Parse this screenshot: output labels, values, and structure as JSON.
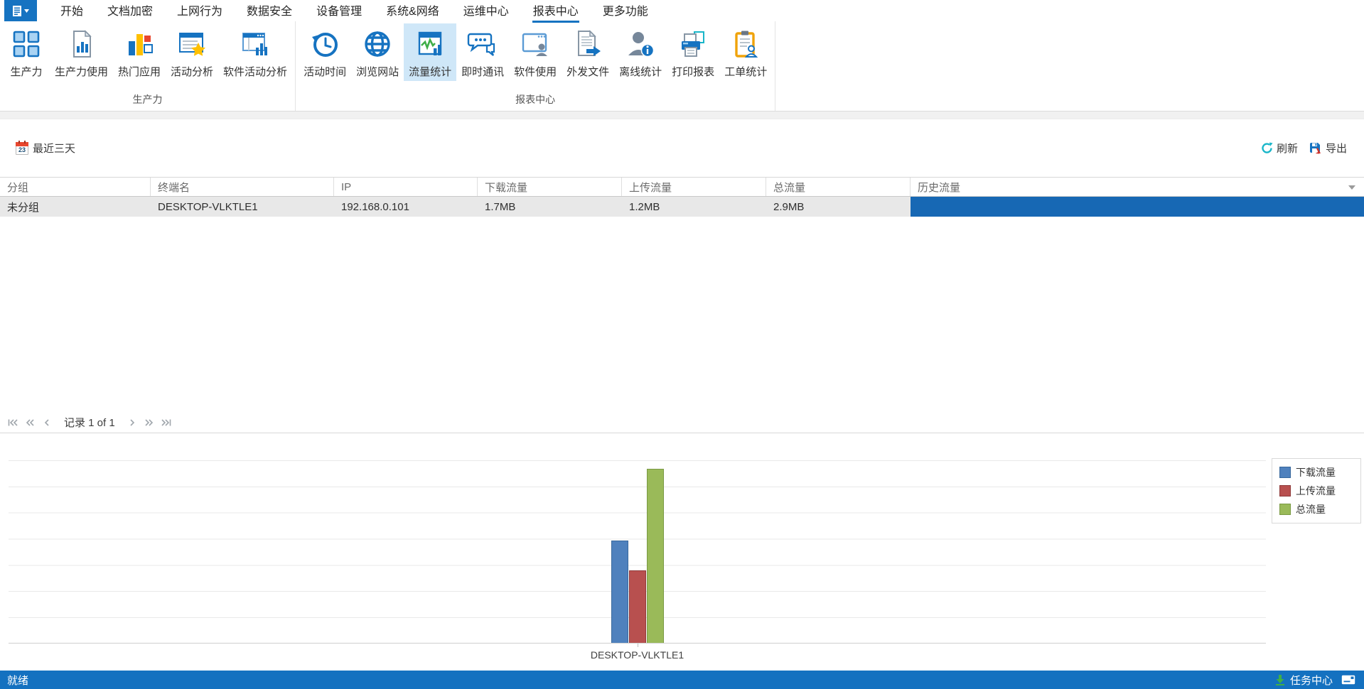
{
  "colors": {
    "accent": "#1673c1",
    "statusbar_bg": "#1471c0",
    "history_bar": "#1768b4",
    "selected_button_bg": "#cfe7f8",
    "row_bg": "#e8e8e8"
  },
  "app": {
    "menu_icon": "document-menu-icon",
    "tabs": [
      {
        "label": "开始",
        "selected": false
      },
      {
        "label": "文档加密",
        "selected": false
      },
      {
        "label": "上网行为",
        "selected": false
      },
      {
        "label": "数据安全",
        "selected": false
      },
      {
        "label": "设备管理",
        "selected": false
      },
      {
        "label": "系统&网络",
        "selected": false
      },
      {
        "label": "运维中心",
        "selected": false
      },
      {
        "label": "报表中心",
        "selected": true
      },
      {
        "label": "更多功能",
        "selected": false
      }
    ]
  },
  "ribbon": {
    "groups": [
      {
        "label": "生产力",
        "buttons": [
          {
            "label": "生产力",
            "icon": "grid-icon",
            "selected": false
          },
          {
            "label": "生产力使用",
            "icon": "document-chart-icon",
            "selected": false
          },
          {
            "label": "热门应用",
            "icon": "bar-chart-icon",
            "selected": false
          },
          {
            "label": "活动分析",
            "icon": "panel-star-icon",
            "selected": false
          },
          {
            "label": "软件活动分析",
            "icon": "window-chart-icon",
            "selected": false
          }
        ]
      },
      {
        "label": "报表中心",
        "buttons": [
          {
            "label": "活动时间",
            "icon": "clock-history-icon",
            "selected": false
          },
          {
            "label": "浏览网站",
            "icon": "globe-icon",
            "selected": false
          },
          {
            "label": "流量统计",
            "icon": "traffic-pulse-icon",
            "selected": true
          },
          {
            "label": "即时通讯",
            "icon": "chat-icon",
            "selected": false
          },
          {
            "label": "软件使用",
            "icon": "window-person-icon",
            "selected": false
          },
          {
            "label": "外发文件",
            "icon": "document-arrow-icon",
            "selected": false
          },
          {
            "label": "离线统计",
            "icon": "person-info-icon",
            "selected": false
          },
          {
            "label": "打印报表",
            "icon": "printer-icon",
            "selected": false
          },
          {
            "label": "工单统计",
            "icon": "clipboard-person-icon",
            "selected": false
          }
        ]
      }
    ]
  },
  "toolbar": {
    "date_filter_label": "最近三天",
    "calendar_day": "23",
    "refresh_label": "刷新",
    "export_label": "导出"
  },
  "table": {
    "columns": [
      "分组",
      "终端名",
      "IP",
      "下载流量",
      "上传流量",
      "总流量",
      "历史流量"
    ],
    "rows": [
      {
        "group": "未分组",
        "terminal": "DESKTOP-VLKTLE1",
        "ip": "192.168.0.101",
        "download": "1.7MB",
        "upload": "1.2MB",
        "total": "2.9MB",
        "history_bar": true
      }
    ]
  },
  "pagination": {
    "label": "记录 1 of 1"
  },
  "chart_data": {
    "type": "bar",
    "title": "",
    "categories": [
      "DESKTOP-VLKTLE1"
    ],
    "series": [
      {
        "name": "下载流量",
        "values": [
          1.7
        ],
        "color": "#4f81bd",
        "border": "#38689c"
      },
      {
        "name": "上传流量",
        "values": [
          1.2
        ],
        "color": "#b8504f",
        "border": "#8e3a3a"
      },
      {
        "name": "总流量",
        "values": [
          2.9
        ],
        "color": "#9aba59",
        "border": "#7a9a43"
      }
    ],
    "unit": "MB",
    "ylim": [
      0,
      3.05
    ],
    "grid": true,
    "legend_position": "top-right",
    "yticks_visible": false
  },
  "status_bar": {
    "ready_label": "就绪",
    "task_center_label": "任务中心"
  }
}
